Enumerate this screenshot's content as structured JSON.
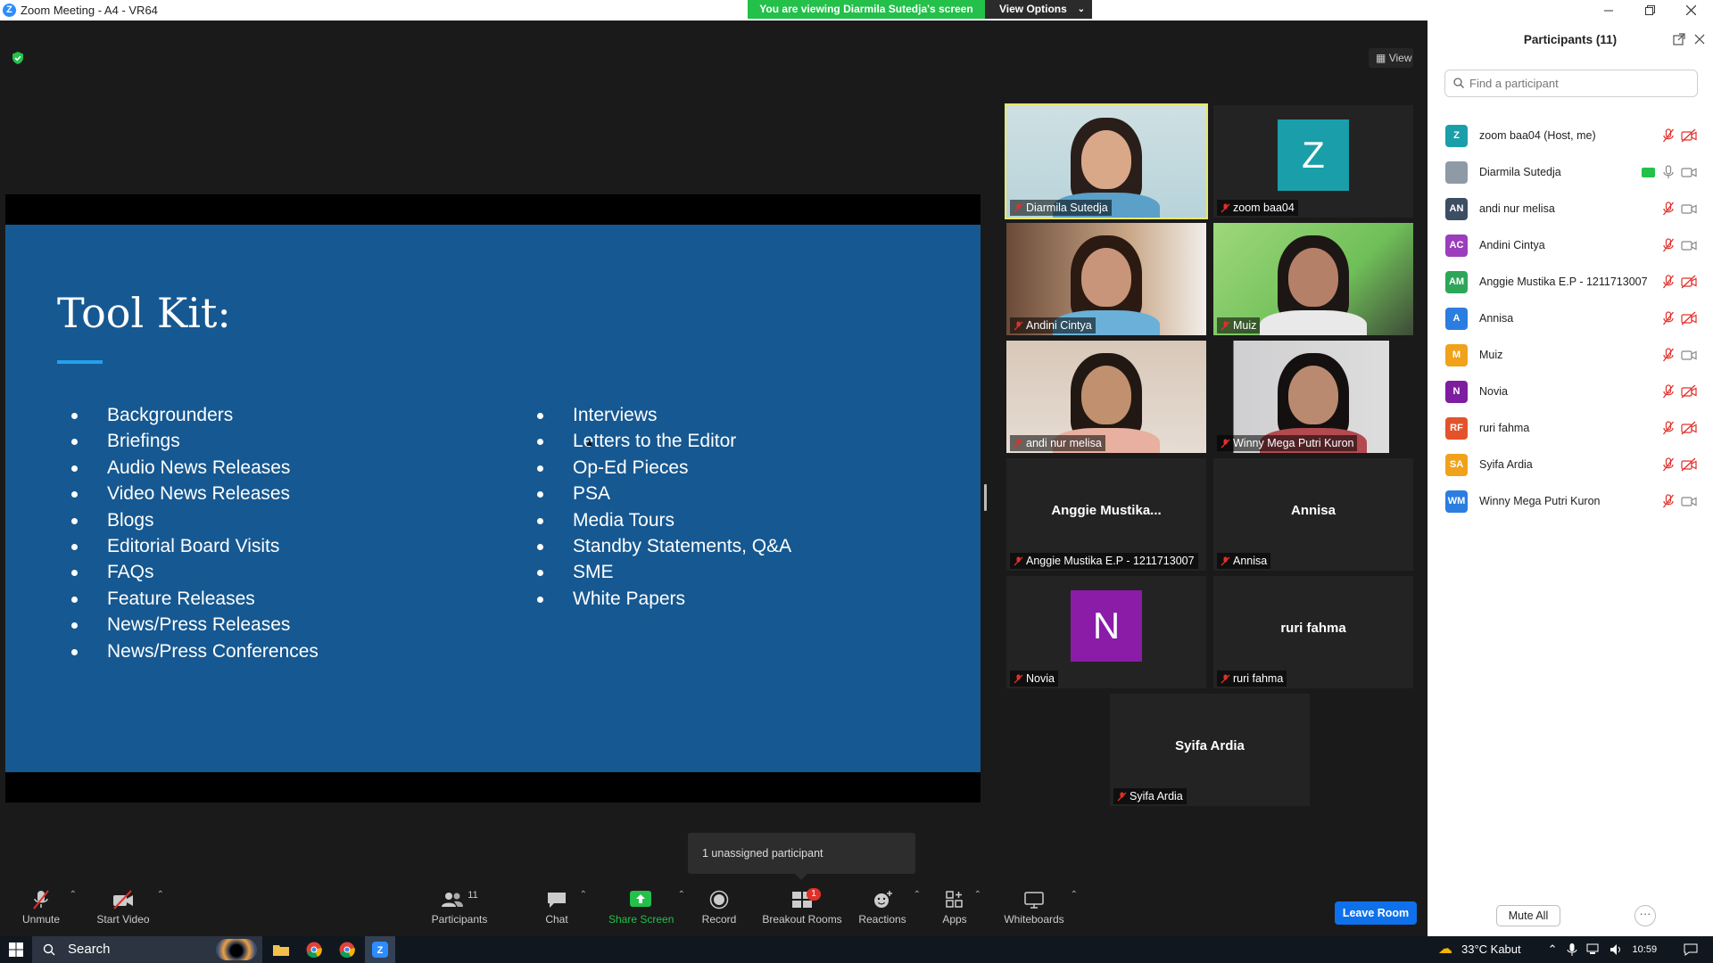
{
  "window": {
    "title": "Zoom Meeting - A4 - VR64"
  },
  "banner": {
    "viewing_text": "You are viewing Diarmila Sutedja's screen",
    "view_options_label": "View Options"
  },
  "stage": {
    "view_label": "View"
  },
  "slide": {
    "title": "Tool Kit:",
    "left_items": [
      "Backgrounders",
      "Briefings",
      "Audio News Releases",
      "Video News Releases",
      "Blogs",
      "Editorial Board Visits",
      "FAQs",
      "Feature Releases",
      "News/Press Releases",
      "News/Press Conferences"
    ],
    "right_items": [
      "Interviews",
      "Letters to the Editor",
      "Op-Ed Pieces",
      "PSA",
      "Media Tours",
      "Standby Statements, Q&A",
      "SME",
      "White Papers"
    ]
  },
  "gallery": {
    "tiles": [
      {
        "name": "Diarmila Sutedja",
        "type": "video",
        "highlighted": true
      },
      {
        "name": "zoom baa04",
        "type": "avatar",
        "initial": "Z",
        "color": "#1a9faa"
      },
      {
        "name": "Andini Cintya",
        "type": "video"
      },
      {
        "name": "Muiz",
        "type": "video"
      },
      {
        "name": "andi nur melisa",
        "type": "video"
      },
      {
        "name": "Winny Mega Putri Kuron",
        "type": "video"
      },
      {
        "name": "Anggie Mustika E.P - 1211713007",
        "type": "name",
        "display": "Anggie  Mustika..."
      },
      {
        "name": "Annisa",
        "type": "name",
        "display": "Annisa"
      },
      {
        "name": "Novia",
        "type": "avatar",
        "initial": "N",
        "color": "#8a1ca8"
      },
      {
        "name": "ruri fahma",
        "type": "name",
        "display": "ruri fahma"
      },
      {
        "name": "Syifa Ardia",
        "type": "name",
        "display": "Syifa Ardia"
      }
    ]
  },
  "tooltip": {
    "text": "1 unassigned participant"
  },
  "toolbar": {
    "unmute": "Unmute",
    "start_video": "Start Video",
    "participants": "Participants",
    "participants_count": "11",
    "chat": "Chat",
    "share_screen": "Share Screen",
    "record": "Record",
    "breakout_rooms": "Breakout Rooms",
    "breakout_badge": "1",
    "reactions": "Reactions",
    "apps": "Apps",
    "whiteboards": "Whiteboards",
    "leave_room": "Leave Room"
  },
  "panel": {
    "title": "Participants (11)",
    "search_placeholder": "Find a participant",
    "participants": [
      {
        "initials": "Z",
        "name": "zoom baa04 (Host, me)",
        "color": "#1a9faa",
        "mic": "muted",
        "cam": "off"
      },
      {
        "initials": "",
        "name": "Diarmila Sutedja",
        "color": "#8e9aa6",
        "mic": "on",
        "cam": "on",
        "sharing": true
      },
      {
        "initials": "AN",
        "name": "andi nur melisa",
        "color": "#3d4e63",
        "mic": "muted",
        "cam": "on"
      },
      {
        "initials": "AC",
        "name": "Andini Cintya",
        "color": "#9b3dbd",
        "mic": "muted",
        "cam": "on"
      },
      {
        "initials": "AM",
        "name": "Anggie Mustika E.P - 1211713007",
        "color": "#2ea65a",
        "mic": "muted",
        "cam": "off"
      },
      {
        "initials": "A",
        "name": "Annisa",
        "color": "#2b7de0",
        "mic": "muted",
        "cam": "off"
      },
      {
        "initials": "M",
        "name": "Muiz",
        "color": "#f0a21c",
        "mic": "muted",
        "cam": "on"
      },
      {
        "initials": "N",
        "name": "Novia",
        "color": "#7d1ea0",
        "mic": "muted",
        "cam": "off"
      },
      {
        "initials": "RF",
        "name": "ruri fahma",
        "color": "#e2532b",
        "mic": "muted",
        "cam": "off"
      },
      {
        "initials": "SA",
        "name": "Syifa Ardia",
        "color": "#f0a21c",
        "mic": "muted",
        "cam": "off"
      },
      {
        "initials": "WM",
        "name": "Winny Mega Putri Kuron",
        "color": "#2b7de0",
        "mic": "muted",
        "cam": "on"
      }
    ],
    "mute_all": "Mute All",
    "more": "···"
  },
  "taskbar": {
    "search_label": "Search",
    "weather": "33°C  Kabut",
    "time": "10:59"
  }
}
